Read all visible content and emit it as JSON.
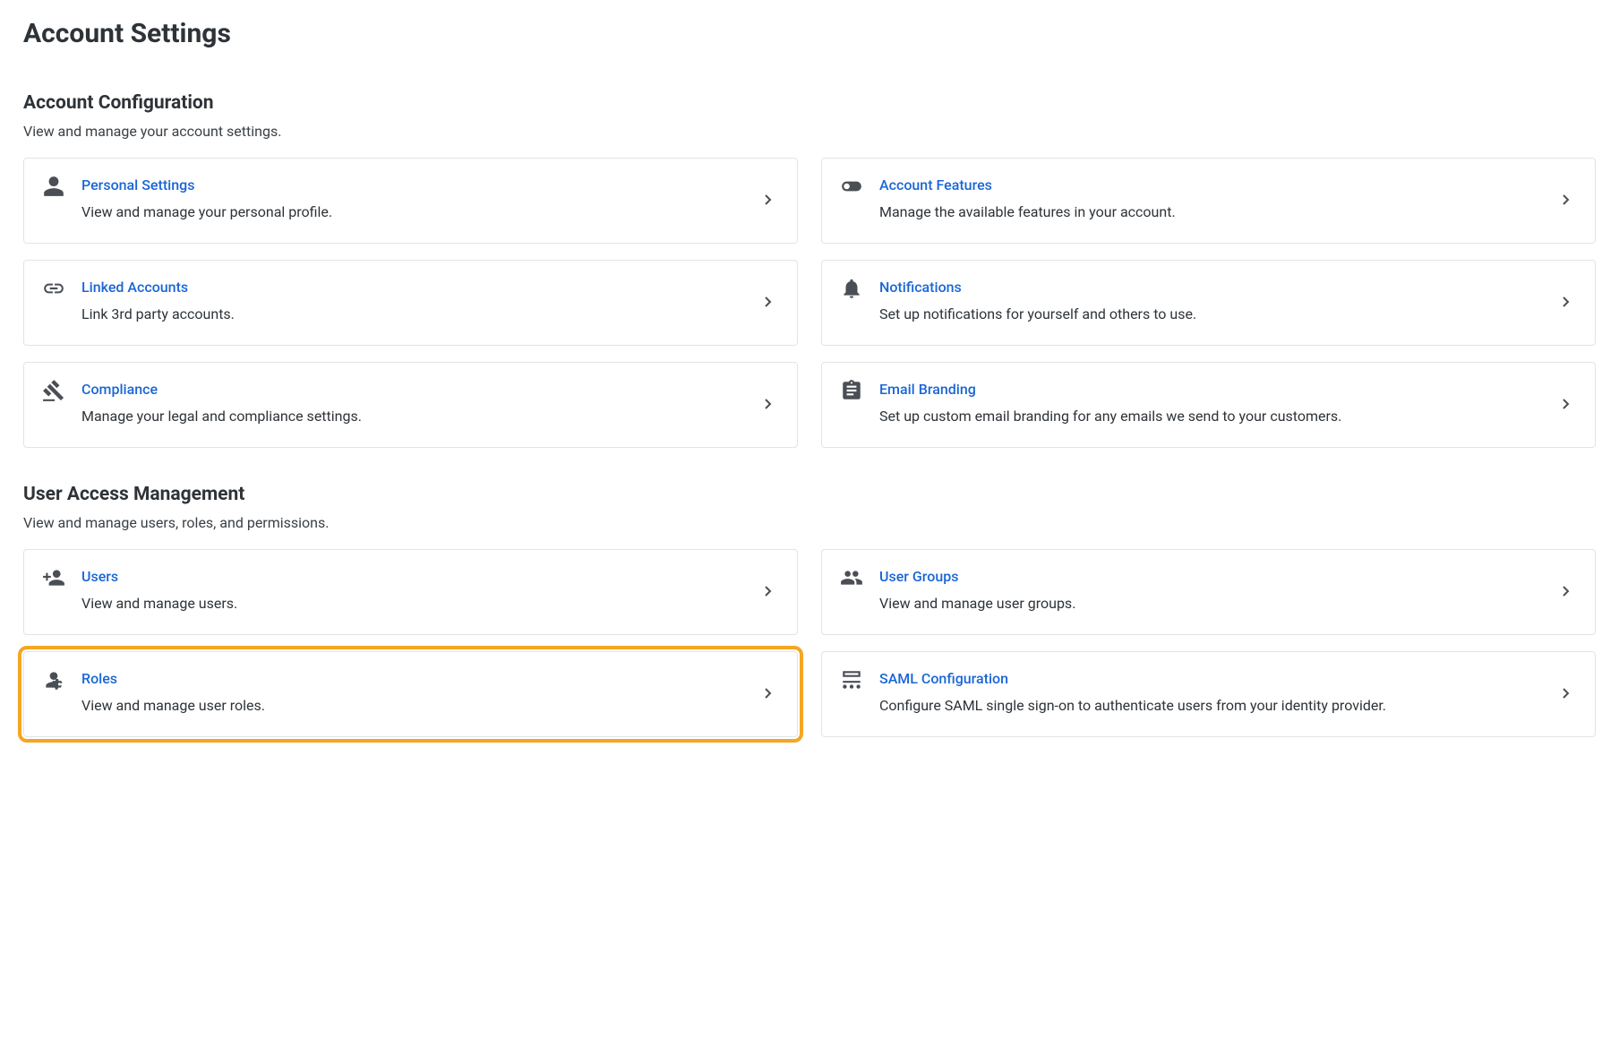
{
  "page": {
    "title": "Account Settings"
  },
  "sections": {
    "accountConfig": {
      "title": "Account Configuration",
      "desc": "View and manage your account settings.",
      "cards": {
        "personalSettings": {
          "title": "Personal Settings",
          "desc": "View and manage your personal profile."
        },
        "accountFeatures": {
          "title": "Account Features",
          "desc": "Manage the available features in your account."
        },
        "linkedAccounts": {
          "title": "Linked Accounts",
          "desc": "Link 3rd party accounts."
        },
        "notifications": {
          "title": "Notifications",
          "desc": "Set up notifications for yourself and others to use."
        },
        "compliance": {
          "title": "Compliance",
          "desc": "Manage your legal and compliance settings."
        },
        "emailBranding": {
          "title": "Email Branding",
          "desc": "Set up custom email branding for any emails we send to your customers."
        }
      }
    },
    "userAccess": {
      "title": "User Access Management",
      "desc": "View and manage users, roles, and permissions.",
      "cards": {
        "users": {
          "title": "Users",
          "desc": "View and manage users."
        },
        "userGroups": {
          "title": "User Groups",
          "desc": "View and manage user groups."
        },
        "roles": {
          "title": "Roles",
          "desc": "View and manage user roles."
        },
        "saml": {
          "title": "SAML Configuration",
          "desc": "Configure SAML single sign-on to authenticate users from your identity provider."
        }
      }
    }
  }
}
